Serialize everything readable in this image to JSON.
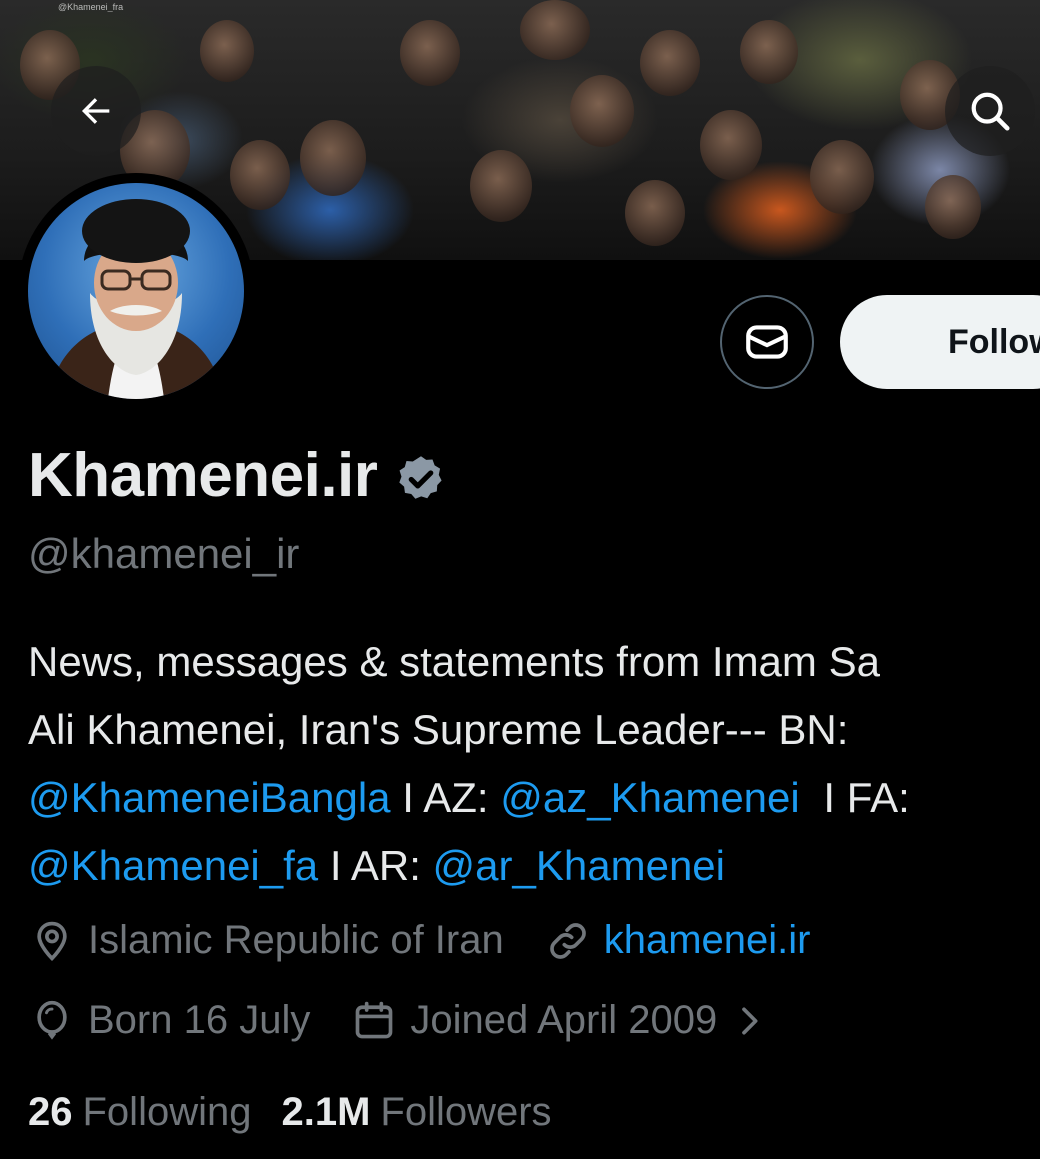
{
  "banner": {
    "watermark": "@Khamenei_fra"
  },
  "profile": {
    "display_name": "Khamenei.ir",
    "handle": "@khamenei_ir",
    "verified": true,
    "follow_label": "Follow",
    "bio": {
      "line1": "News, messages & statements from Imam Sa",
      "line2": "Ali Khamenei, Iran's Supreme Leader--- BN:",
      "mention_bangla": "@KhameneiBangla",
      "sep_az": " I AZ: ",
      "mention_az": "@az_Khamenei",
      "sep_fa": " I FA:",
      "mention_fa": "@Khamenei_fa",
      "sep_ar": " I AR: ",
      "mention_ar": "@ar_Khamenei"
    },
    "location": "Islamic Republic of Iran",
    "website": "khamenei.ir",
    "birthday": "Born 16 July",
    "joined": "Joined April 2009",
    "following_count": "26",
    "following_label": "Following",
    "followers_count": "2.1M",
    "followers_label": "Followers"
  },
  "icons": {
    "back": "arrow-left-icon",
    "search": "search-icon",
    "message": "mail-icon",
    "verified": "verified-badge-icon",
    "location": "location-pin-icon",
    "link": "link-icon",
    "birthday": "balloon-icon",
    "calendar": "calendar-icon",
    "chevron": "chevron-right-icon"
  },
  "colors": {
    "background": "#000000",
    "text": "#e7e9ea",
    "muted": "#71767b",
    "link": "#1d9bf0",
    "follow_button_bg": "#eff3f4"
  }
}
